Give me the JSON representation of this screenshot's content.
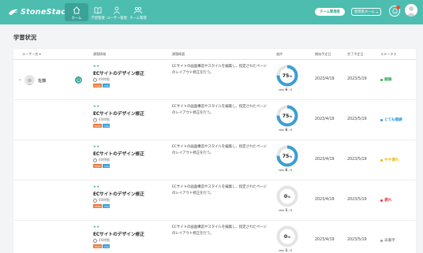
{
  "header": {
    "logo": "StoneStackr",
    "nav": [
      {
        "label": "ホーム",
        "icon": "home-icon"
      },
      {
        "label": "学習管理",
        "icon": "book-icon"
      },
      {
        "label": "ユーザー管理",
        "icon": "user-icon"
      },
      {
        "label": "チーム管理",
        "icon": "team-icon"
      }
    ],
    "team_button": "チーム管理者",
    "select_value": "管理者ホーム",
    "colors": {
      "header": "#4dbdb0",
      "active": "#3aa296"
    }
  },
  "page": {
    "title": "学習状況"
  },
  "table": {
    "headers": {
      "user": "ユーザー名",
      "course_info": "課題情報",
      "overview": "課題概要",
      "progress": "進捗",
      "start_date": "開始予定日",
      "end_date": "完了予定日",
      "status": "ステータス"
    },
    "user_name": "佐藤",
    "rows": [
      {
        "stars": "★★",
        "title": "ECサイトのデザイン修正",
        "hours": "40時間",
        "tags": [
          "HTML",
          "CSS"
        ],
        "description": "ECサイトの画面構造やスタイルを編集し、指定されたページのレイアウト修正を行う。",
        "progress": 75,
        "step_label": "step",
        "step_current": "6",
        "step_total": "/ 8",
        "start": "2023/4/19",
        "end": "2023/5/19",
        "status": "順調",
        "status_color": "#2eaa52"
      },
      {
        "stars": "★★",
        "title": "ECサイトのデザイン修正",
        "hours": "40時間",
        "tags": [
          "HTML",
          "CSS"
        ],
        "description": "ECサイトの画面構造やスタイルを編集し、指定されたページのレイアウト修正を行う。",
        "progress": 75,
        "step_label": "step",
        "step_current": "6",
        "step_total": "/ 8",
        "start": "2023/4/19",
        "end": "2023/5/19",
        "status": "とても順調",
        "status_color": "#2b9cd8"
      },
      {
        "stars": "★★",
        "title": "ECサイトのデザイン修正",
        "hours": "40時間",
        "tags": [
          "HTML",
          "CSS"
        ],
        "description": "ECサイトの画面構造やスタイルを編集し、指定されたページのレイアウト修正を行う。",
        "progress": 75,
        "step_label": "step",
        "step_current": "6",
        "step_total": "/ 8",
        "start": "2023/4/19",
        "end": "2023/5/19",
        "status": "やや遅れ",
        "status_color": "#e8b400"
      },
      {
        "stars": "★★",
        "title": "ECサイトのデザイン修正",
        "hours": "40時間",
        "tags": [
          "HTML",
          "CSS"
        ],
        "description": "ECサイトの画面構造やスタイルを編集し、指定されたページのレイアウト修正を行う。",
        "progress": 0,
        "step_label": "step",
        "step_current": "1",
        "step_total": "/ 8",
        "start": "2023/4/19",
        "end": "2023/5/19",
        "status": "遅れ",
        "status_color": "#e23b3b"
      },
      {
        "stars": "★★",
        "title": "ECサイトのデザイン修正",
        "hours": "40時間",
        "tags": [
          "HTML",
          "CSS"
        ],
        "description": "ECサイトの画面構造やスタイルを編集し、指定されたページのレイアウト修正を行う。",
        "progress": 0,
        "step_label": "step",
        "step_current": "1",
        "step_total": "/ 8",
        "start": "2023/4/19",
        "end": "2023/5/19",
        "status": "未着手",
        "status_color": "#9a9a9a"
      }
    ],
    "tag_colors": {
      "HTML": "#ef7a3c",
      "CSS": "#3aa0d8"
    },
    "progress_color": "#3a9fd3",
    "progress_track": "#e4e4e4"
  }
}
